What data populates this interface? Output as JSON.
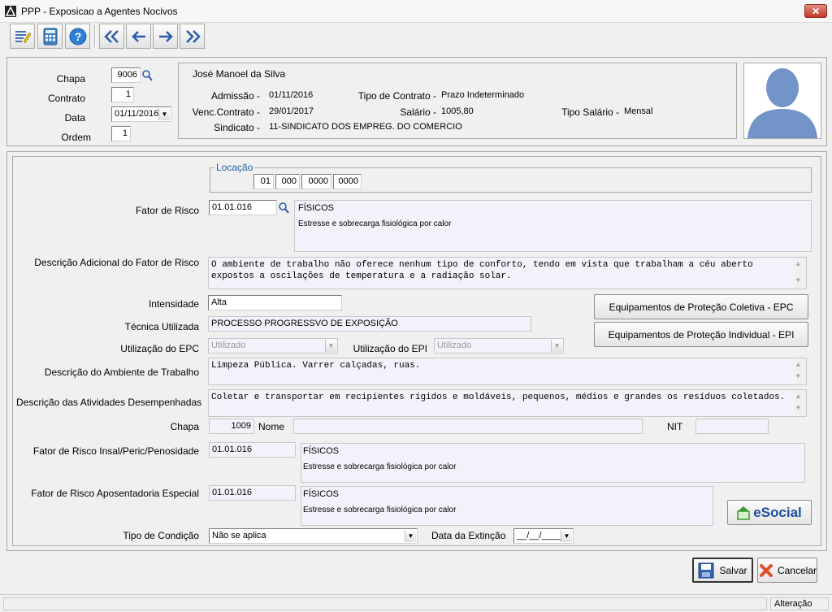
{
  "window": {
    "title": "PPP - Exposicao a Agentes Nocivos",
    "close_label": "✕"
  },
  "toolbar": {
    "icons": [
      "edit-icon",
      "calculator-icon",
      "help-icon",
      "first-record-icon",
      "previous-record-icon",
      "next-record-icon",
      "last-record-icon"
    ]
  },
  "header": {
    "chapa_label": "Chapa",
    "chapa_value": "9006",
    "contrato_label": "Contrato",
    "contrato_value": "1",
    "data_label": "Data",
    "data_value": "01/11/2016",
    "ordem_label": "Ordem",
    "ordem_value": "1"
  },
  "employee": {
    "name": "José Manoel da Silva",
    "admissao_label": "Admissão -",
    "admissao_value": "01/11/2016",
    "tipo_contrato_label": "Tipo de Contrato -",
    "tipo_contrato_value": "Prazo Indeterminado",
    "venc_label": "Venc.Contrato -",
    "venc_value": "29/01/2017",
    "salario_label": "Salário -",
    "salario_value": "1005,80",
    "tipo_salario_label": "Tipo Salário -",
    "tipo_salario_value": "Mensal",
    "sindicato_label": "Sindicato -",
    "sindicato_value": "11-SINDICATO DOS EMPREG. DO COMERCIO"
  },
  "form": {
    "locacao_label": "Locação",
    "locacao_values": [
      "01",
      "000",
      "0000",
      "0000"
    ],
    "fator_risco_label": "Fator de Risco",
    "fator_risco_code": "01.01.016",
    "fator_risco_type": "FÍSICOS",
    "fator_risco_desc": "Estresse e sobrecarga fisiológica por calor",
    "desc_adicional_label": "Descrição Adicional do Fator de Risco",
    "desc_adicional_line1": "O ambiente de trabalho não oferece nenhum tipo de conforto, tendo em vista que trabalham a céu aberto",
    "desc_adicional_line2": "expostos a oscilações de temperatura e a radiação solar.",
    "intensidade_label": "Intensidade",
    "intensidade_value": "Alta",
    "tecnica_label": "Técnica Utilizada",
    "tecnica_value": "PROCESSO PROGRESSVO DE EXPOSIÇÃO",
    "epc_label": "Utilização do EPC",
    "epc_value": "Utilizado",
    "epi_label": "Utilização do EPI",
    "epi_value": "Utilizado",
    "btn_epc": "Equipamentos de Proteção Coletiva - EPC",
    "btn_epi": "Equipamentos de Proteção Individual - EPI",
    "ambiente_label": "Descrição do Ambiente de Trabalho",
    "ambiente_value": "Limpeza Pública. Varrer calçadas, ruas.",
    "atividades_label": "Descrição das Atividades Desempenhadas",
    "atividades_value": "Coletar e transportar em recipientes rígidos e moldáveis, pequenos, médios e grandes os resíduos coletados.",
    "chapa2_label": "Chapa",
    "chapa2_value": "1009",
    "nome_label": "Nome",
    "nome_value": "",
    "nit_label": "NIT",
    "nit_value": "",
    "insal_label": "Fator de Risco Insal/Peric/Penosidade",
    "insal_code": "01.01.016",
    "insal_type": "FÍSICOS",
    "insal_desc": "Estresse e sobrecarga fisiológica por calor",
    "apos_label": "Fator de Risco Aposentadoria Especial",
    "apos_code": "01.01.016",
    "apos_type": "FÍSICOS",
    "apos_desc": "Estresse e sobrecarga fisiológica por calor",
    "condicao_label": "Tipo de Condição",
    "condicao_value": "Não se aplica",
    "extincao_label": "Data da Extinção",
    "extincao_value": "__/__/____",
    "esocial_label": "eSocial"
  },
  "actions": {
    "salvar": "Salvar",
    "cancelar": "Cancelar"
  },
  "status": {
    "mode": "Alteração"
  },
  "colors": {
    "accent_blue": "#1f5fa8",
    "window_bg": "#f0f0f0",
    "field_bg": "#f2f3fa"
  }
}
